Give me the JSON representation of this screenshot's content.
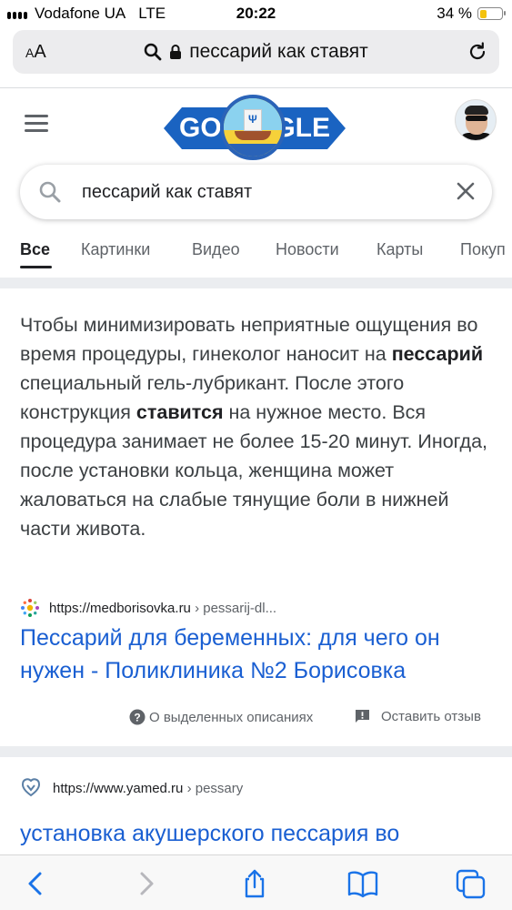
{
  "status_bar": {
    "carrier": "Vodafone UA",
    "network": "LTE",
    "time": "20:22",
    "battery_text": "34 %",
    "battery_level": 0.34,
    "battery_color": "#f4c20d"
  },
  "address_bar": {
    "text_size_label_small": "A",
    "text_size_label_large": "A",
    "url_text": "пессарий как ставят",
    "icons": [
      "search-icon",
      "lock-icon",
      "reload-icon"
    ]
  },
  "google_header": {
    "logo_text_left": "GO",
    "logo_text_right": "GLE",
    "logo_colors": {
      "plate": "#1a63c1",
      "disk": "#f6d13a"
    },
    "icons": [
      "menu-icon",
      "avatar"
    ]
  },
  "search": {
    "query": "пессарий как ставят",
    "icons": [
      "search-icon",
      "clear-icon"
    ]
  },
  "tabs": [
    {
      "label": "Все",
      "active": true
    },
    {
      "label": "Картинки",
      "active": false
    },
    {
      "label": "Видео",
      "active": false
    },
    {
      "label": "Новости",
      "active": false
    },
    {
      "label": "Карты",
      "active": false
    },
    {
      "label": "Покуп",
      "active": false
    }
  ],
  "featured_snippet": {
    "p1": "Чтобы минимизировать неприятные ощущения во время процедуры, гинеколог наносит на ",
    "b1": "пессарий",
    "p2": " специальный гель-лубрикант. После этого конструкция ",
    "b2": "ставится",
    "p3": " на нужное место. Вся процедура занимает не более 15-20 минут. Иногда, после установки кольца, женщина может жаловаться на слабые тянущие боли в нижней части живота.",
    "source_url": "https://medborisovka.ru",
    "source_path": "› pessarij-dl...",
    "title": "Пессарий для беременных: для чего он нужен - Поликлиника №2 Борисовка",
    "about_label": "О выделенных описаниях",
    "feedback_label": "Оставить отзыв"
  },
  "result_2": {
    "source_url": "https://www.yamed.ru",
    "source_path": "› pessary",
    "title": "установка акушерского пессария во"
  },
  "bottom_toolbar": {
    "icons": [
      "back-icon",
      "forward-icon",
      "share-icon",
      "bookmarks-icon",
      "tabs-icon"
    ]
  },
  "colors": {
    "link": "#1a5fd2",
    "accent_blue": "#1a73e8"
  }
}
